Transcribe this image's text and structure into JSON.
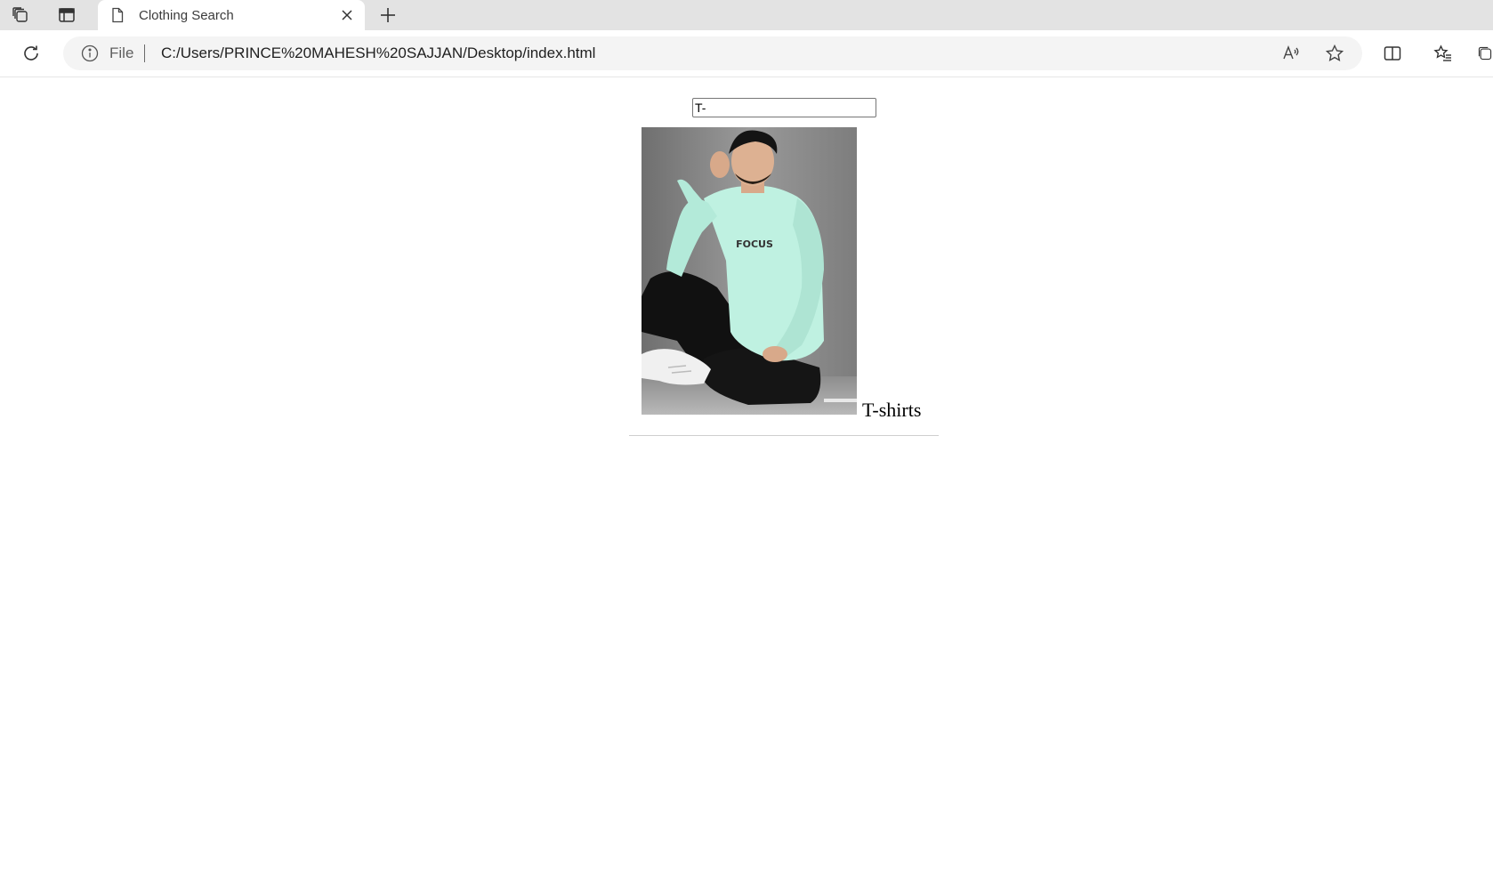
{
  "browser": {
    "tab": {
      "title": "Clothing Search",
      "icons": [
        "workspaces-icon",
        "vertical-tabs-icon",
        "page-icon",
        "close-icon",
        "new-tab-icon"
      ]
    },
    "address_bar": {
      "scheme_label": "File",
      "url": "C:/Users/PRINCE%20MAHESH%20SAJJAN/Desktop/index.html",
      "icons": [
        "info-icon",
        "read-aloud-icon",
        "favorite-star-icon"
      ]
    },
    "toolbar_icons": [
      "reload-icon",
      "split-screen-icon",
      "favorites-icon",
      "collections-icon"
    ]
  },
  "page": {
    "search": {
      "value": "T-",
      "placeholder": ""
    },
    "results": [
      {
        "name": "T-shirts",
        "image_alt": "man in mint long-sleeve tee sitting",
        "shirt_print": "FOCUS"
      }
    ]
  },
  "colors": {
    "tabstrip_bg": "#e3e3e3",
    "omnibox_bg": "#f4f4f4",
    "shirt_mint": "#bff1e1",
    "photo_backdrop": "#8a8a8a"
  }
}
